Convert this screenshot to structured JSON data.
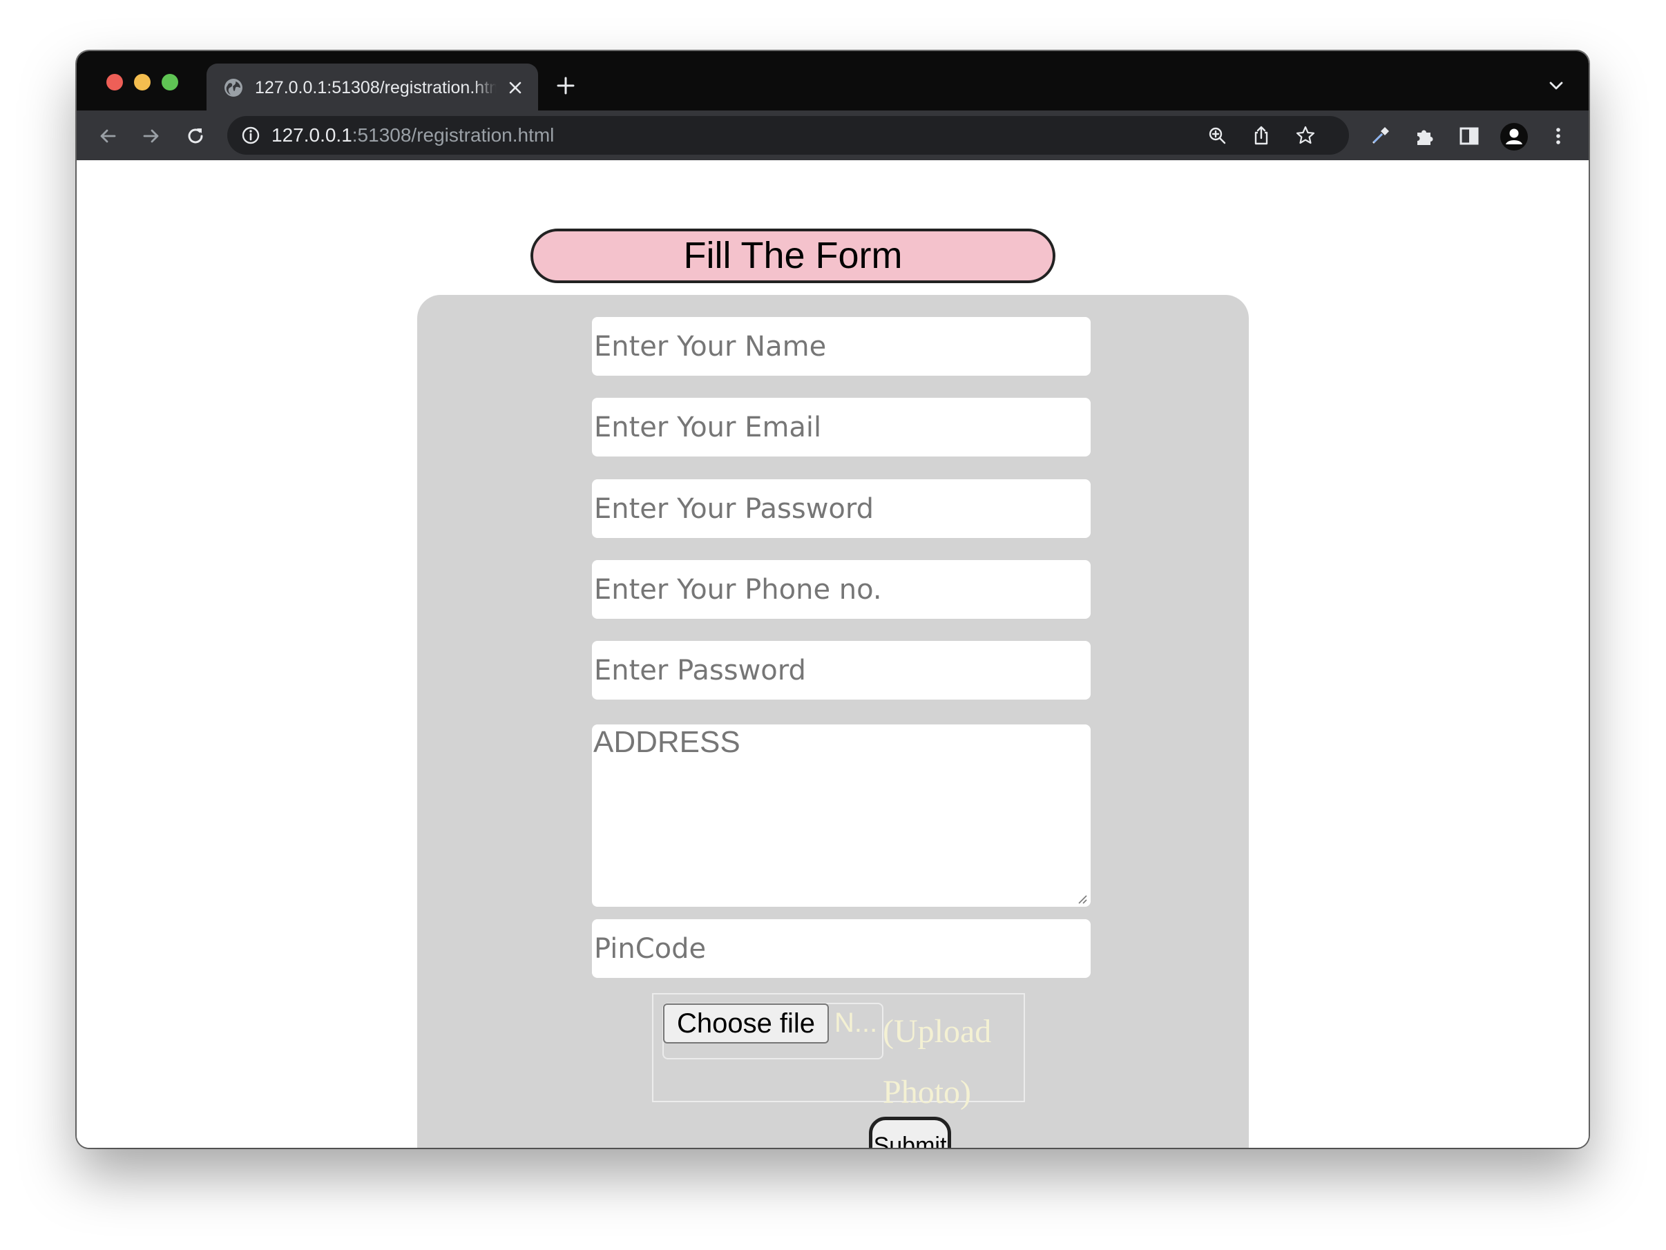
{
  "browser": {
    "tab_title": "127.0.0.1:51308/registration.html",
    "url_host": "127.0.0.1",
    "url_rest": ":51308/registration.html",
    "colors": {
      "frame": "#0c0c0c",
      "toolbar": "#35363a",
      "omnibox": "#202124",
      "text": "#e8eaed"
    },
    "icons": [
      "globe-icon",
      "close-icon",
      "plus-icon",
      "chevron-down-icon",
      "back-arrow-icon",
      "forward-arrow-icon",
      "reload-icon",
      "info-icon",
      "zoom-icon",
      "share-icon",
      "star-icon",
      "eyedropper-icon",
      "puzzle-icon",
      "sidepanel-icon",
      "profile-icon",
      "kebab-menu-icon"
    ]
  },
  "form": {
    "title": "Fill The Form",
    "colors": {
      "title_bg": "#f4c2cc",
      "panel_bg": "#d3d3d3",
      "upload_label": "#f4f1d3"
    },
    "fields": {
      "name_placeholder": "Enter Your Name",
      "email_placeholder": "Enter Your Email",
      "password_placeholder": "Enter Your Password",
      "phone_placeholder": "Enter Your Phone no.",
      "confirm_password_placeholder": "Enter Password",
      "address_placeholder": "ADDRESS",
      "pincode_placeholder": "PinCode"
    },
    "file": {
      "choose_label": "Choose file",
      "no_file_text": "N...",
      "upload_label": "(Upload Photo)"
    },
    "submit_label": "Submit"
  }
}
